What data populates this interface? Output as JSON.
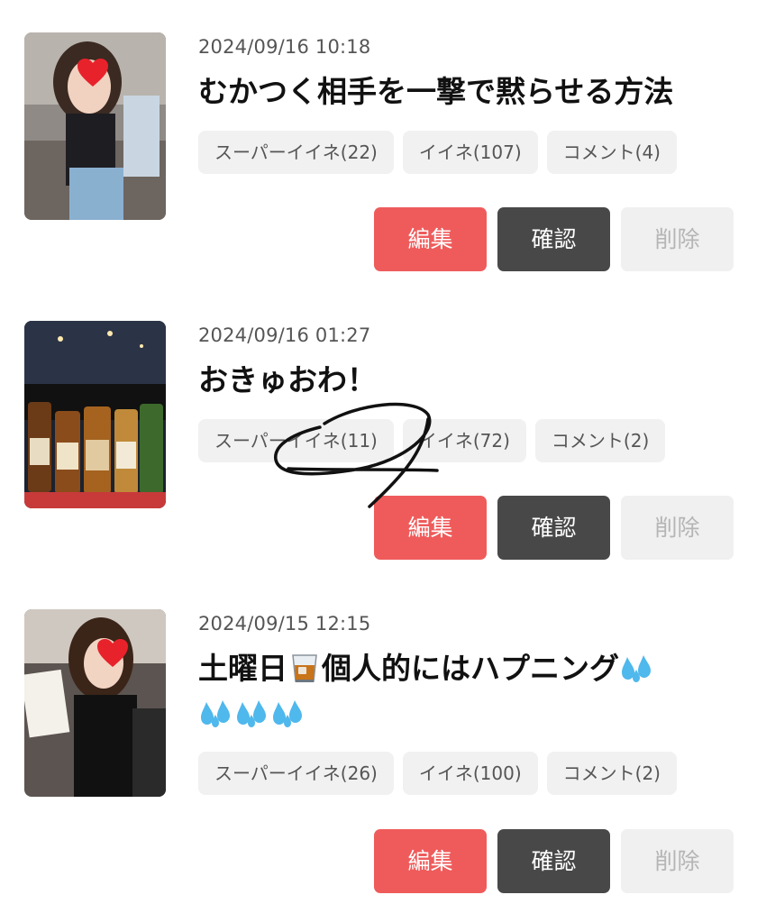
{
  "posts": [
    {
      "date": "2024/09/16 10:18",
      "title": "むかつく相手を一撃で黙らせる方法",
      "stats": {
        "super_like": "スーパーイイネ(22)",
        "like": "イイネ(107)",
        "comment": "コメント(4)"
      },
      "actions": {
        "edit": "編集",
        "confirm": "確認",
        "delete": "削除"
      }
    },
    {
      "date": "2024/09/16 01:27",
      "title": "おきゅおわ！",
      "stats": {
        "super_like": "スーパーイイネ(11)",
        "like": "イイネ(72)",
        "comment": "コメント(2)"
      },
      "actions": {
        "edit": "編集",
        "confirm": "確認",
        "delete": "削除"
      }
    },
    {
      "date": "2024/09/15 12:15",
      "title_part1": "土曜日",
      "title_part2": "個人的にはハプニング",
      "stats": {
        "super_like": "スーパーイイネ(26)",
        "like": "イイネ(100)",
        "comment": "コメント(2)"
      },
      "actions": {
        "edit": "編集",
        "confirm": "確認",
        "delete": "削除"
      }
    }
  ],
  "colors": {
    "edit_button": "#ef5b5b",
    "confirm_button": "#484848",
    "delete_button": "#f0f0f0",
    "chip_background": "#f1f1f1"
  },
  "icons": {
    "title_emoji_1": "whiskey-glass-icon",
    "title_emoji_2": "sweat-droplets-icon",
    "thumbnail_overlay": "heart-icon"
  }
}
